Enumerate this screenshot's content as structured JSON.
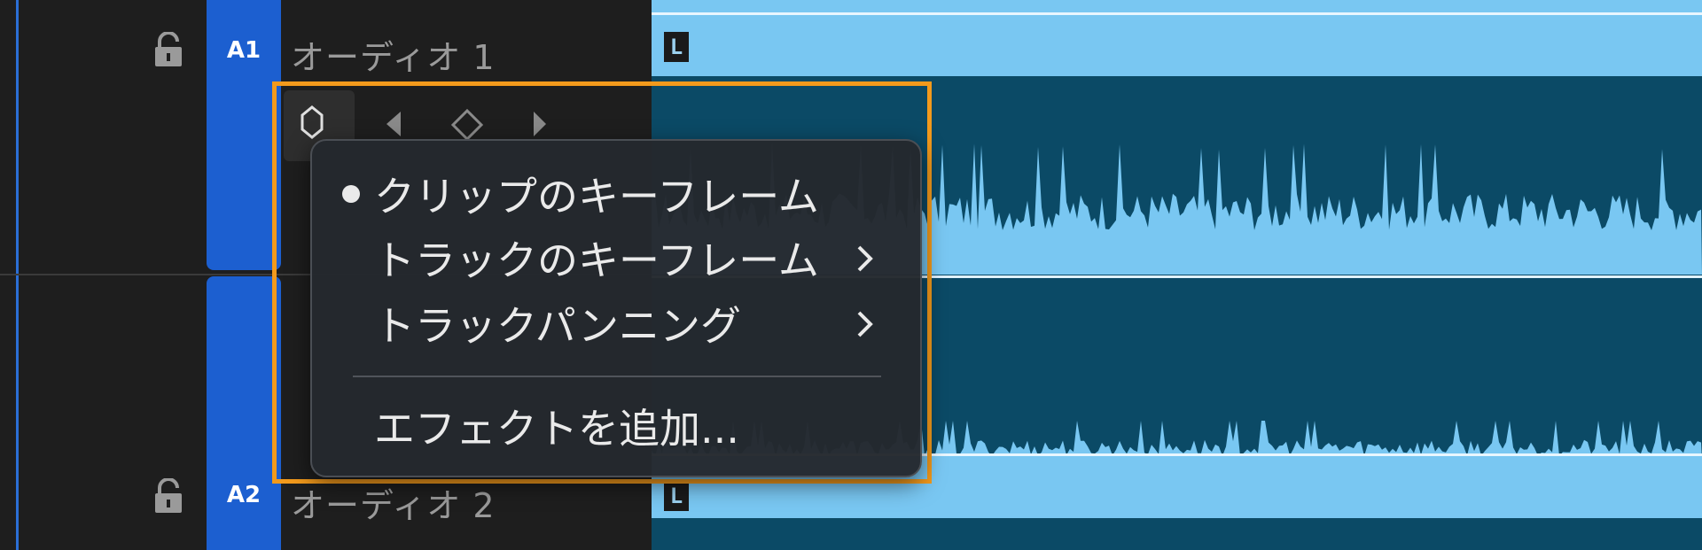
{
  "tracks": [
    {
      "id": "A1",
      "name": "オーディオ 1",
      "channel": "L"
    },
    {
      "id": "A2",
      "name": "オーディオ 2",
      "channel": "L"
    }
  ],
  "context_menu": {
    "items": [
      {
        "label": "クリップのキーフレーム",
        "selected": true,
        "submenu": false
      },
      {
        "label": "トラックのキーフレーム",
        "selected": false,
        "submenu": true
      },
      {
        "label": "トラックパンニング",
        "selected": false,
        "submenu": true
      },
      {
        "label": "エフェクトを追加...",
        "selected": false,
        "submenu": false
      }
    ]
  },
  "icons": [
    "lock-icon",
    "keyframe-mode-icon",
    "previous-keyframe-icon",
    "add-keyframe-icon",
    "next-keyframe-icon",
    "chevron-right-icon"
  ],
  "colors": {
    "highlight": "#f39a1c",
    "track_tab": "#1c5fd0",
    "waveform": "#79c7f2",
    "timeline_bg": "#0b4a66"
  }
}
